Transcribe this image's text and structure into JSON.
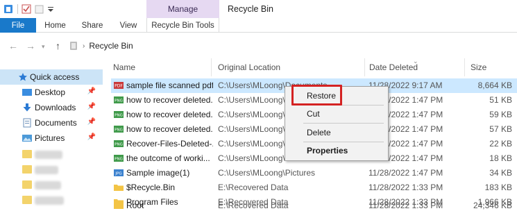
{
  "ribbon": {
    "manage_label": "Manage",
    "window_title": "Recycle Bin",
    "tabs": [
      {
        "label": "File"
      },
      {
        "label": "Home"
      },
      {
        "label": "Share"
      },
      {
        "label": "View"
      },
      {
        "label": "Recycle Bin Tools"
      }
    ]
  },
  "address": {
    "crumb": "Recycle Bin"
  },
  "navpane": {
    "items": [
      {
        "label": "Quick access",
        "icon": "star-icon"
      },
      {
        "label": "Desktop",
        "icon": "desktop-icon"
      },
      {
        "label": "Downloads",
        "icon": "download-arrow-icon"
      },
      {
        "label": "Documents",
        "icon": "documents-icon"
      },
      {
        "label": "Pictures",
        "icon": "pictures-icon"
      }
    ]
  },
  "columns": {
    "name": "Name",
    "location": "Original Location",
    "date": "Date Deleted",
    "size": "Size"
  },
  "rows": [
    {
      "name": "sample file scanned pdf",
      "location": "C:\\Users\\MLoong\\Documents",
      "date": "11/28/2022 9:17 AM",
      "size": "8,664 KB",
      "icon": "pdf-file-icon"
    },
    {
      "name": "how to recover deleted...",
      "location": "C:\\Users\\MLoong\\P",
      "date": "11/28/2022 1:47 PM",
      "size": "51 KB",
      "icon": "image-file-icon"
    },
    {
      "name": "how to recover deleted...",
      "location": "C:\\Users\\MLoong\\P",
      "date": "11/28/2022 1:47 PM",
      "size": "59 KB",
      "icon": "image-file-icon"
    },
    {
      "name": "how to recover deleted...",
      "location": "C:\\Users\\MLoong\\P",
      "date": "11/28/2022 1:47 PM",
      "size": "57 KB",
      "icon": "image-file-icon"
    },
    {
      "name": "Recover-Files-Deleted-...",
      "location": "C:\\Users\\MLoong\\P",
      "date": "11/28/2022 1:47 PM",
      "size": "22 KB",
      "icon": "image-file-icon"
    },
    {
      "name": "the  outcome of worki...",
      "location": "C:\\Users\\MLoong\\P",
      "date": "11/28/2022 1:47 PM",
      "size": "18 KB",
      "icon": "image-file-icon"
    },
    {
      "name": "Sample image(1)",
      "location": "C:\\Users\\MLoong\\Pictures",
      "date": "11/28/2022 1:47 PM",
      "size": "34 KB",
      "icon": "jpg-file-icon"
    },
    {
      "name": "$Recycle.Bin",
      "location": "E:\\Recovered Data",
      "date": "11/28/2022 1:33 PM",
      "size": "183 KB",
      "icon": "folder-icon"
    },
    {
      "name": "Program Files",
      "location": "E:\\Recovered Data",
      "date": "11/28/2022 1:33 PM",
      "size": "1,966 KB",
      "icon": "folder-icon"
    },
    {
      "name": "Root",
      "location": "E:\\Recovered Data",
      "date": "11/28/2022 1:33 PM",
      "size": "24,346 KB",
      "icon": "folder-icon"
    }
  ],
  "context_menu": {
    "restore": "Restore",
    "cut": "Cut",
    "delete": "Delete",
    "properties": "Properties"
  },
  "colors": {
    "accent": "#1979ca",
    "manage_band": "#e6d9f2",
    "selection": "#cce8ff",
    "highlight": "#d42323"
  }
}
